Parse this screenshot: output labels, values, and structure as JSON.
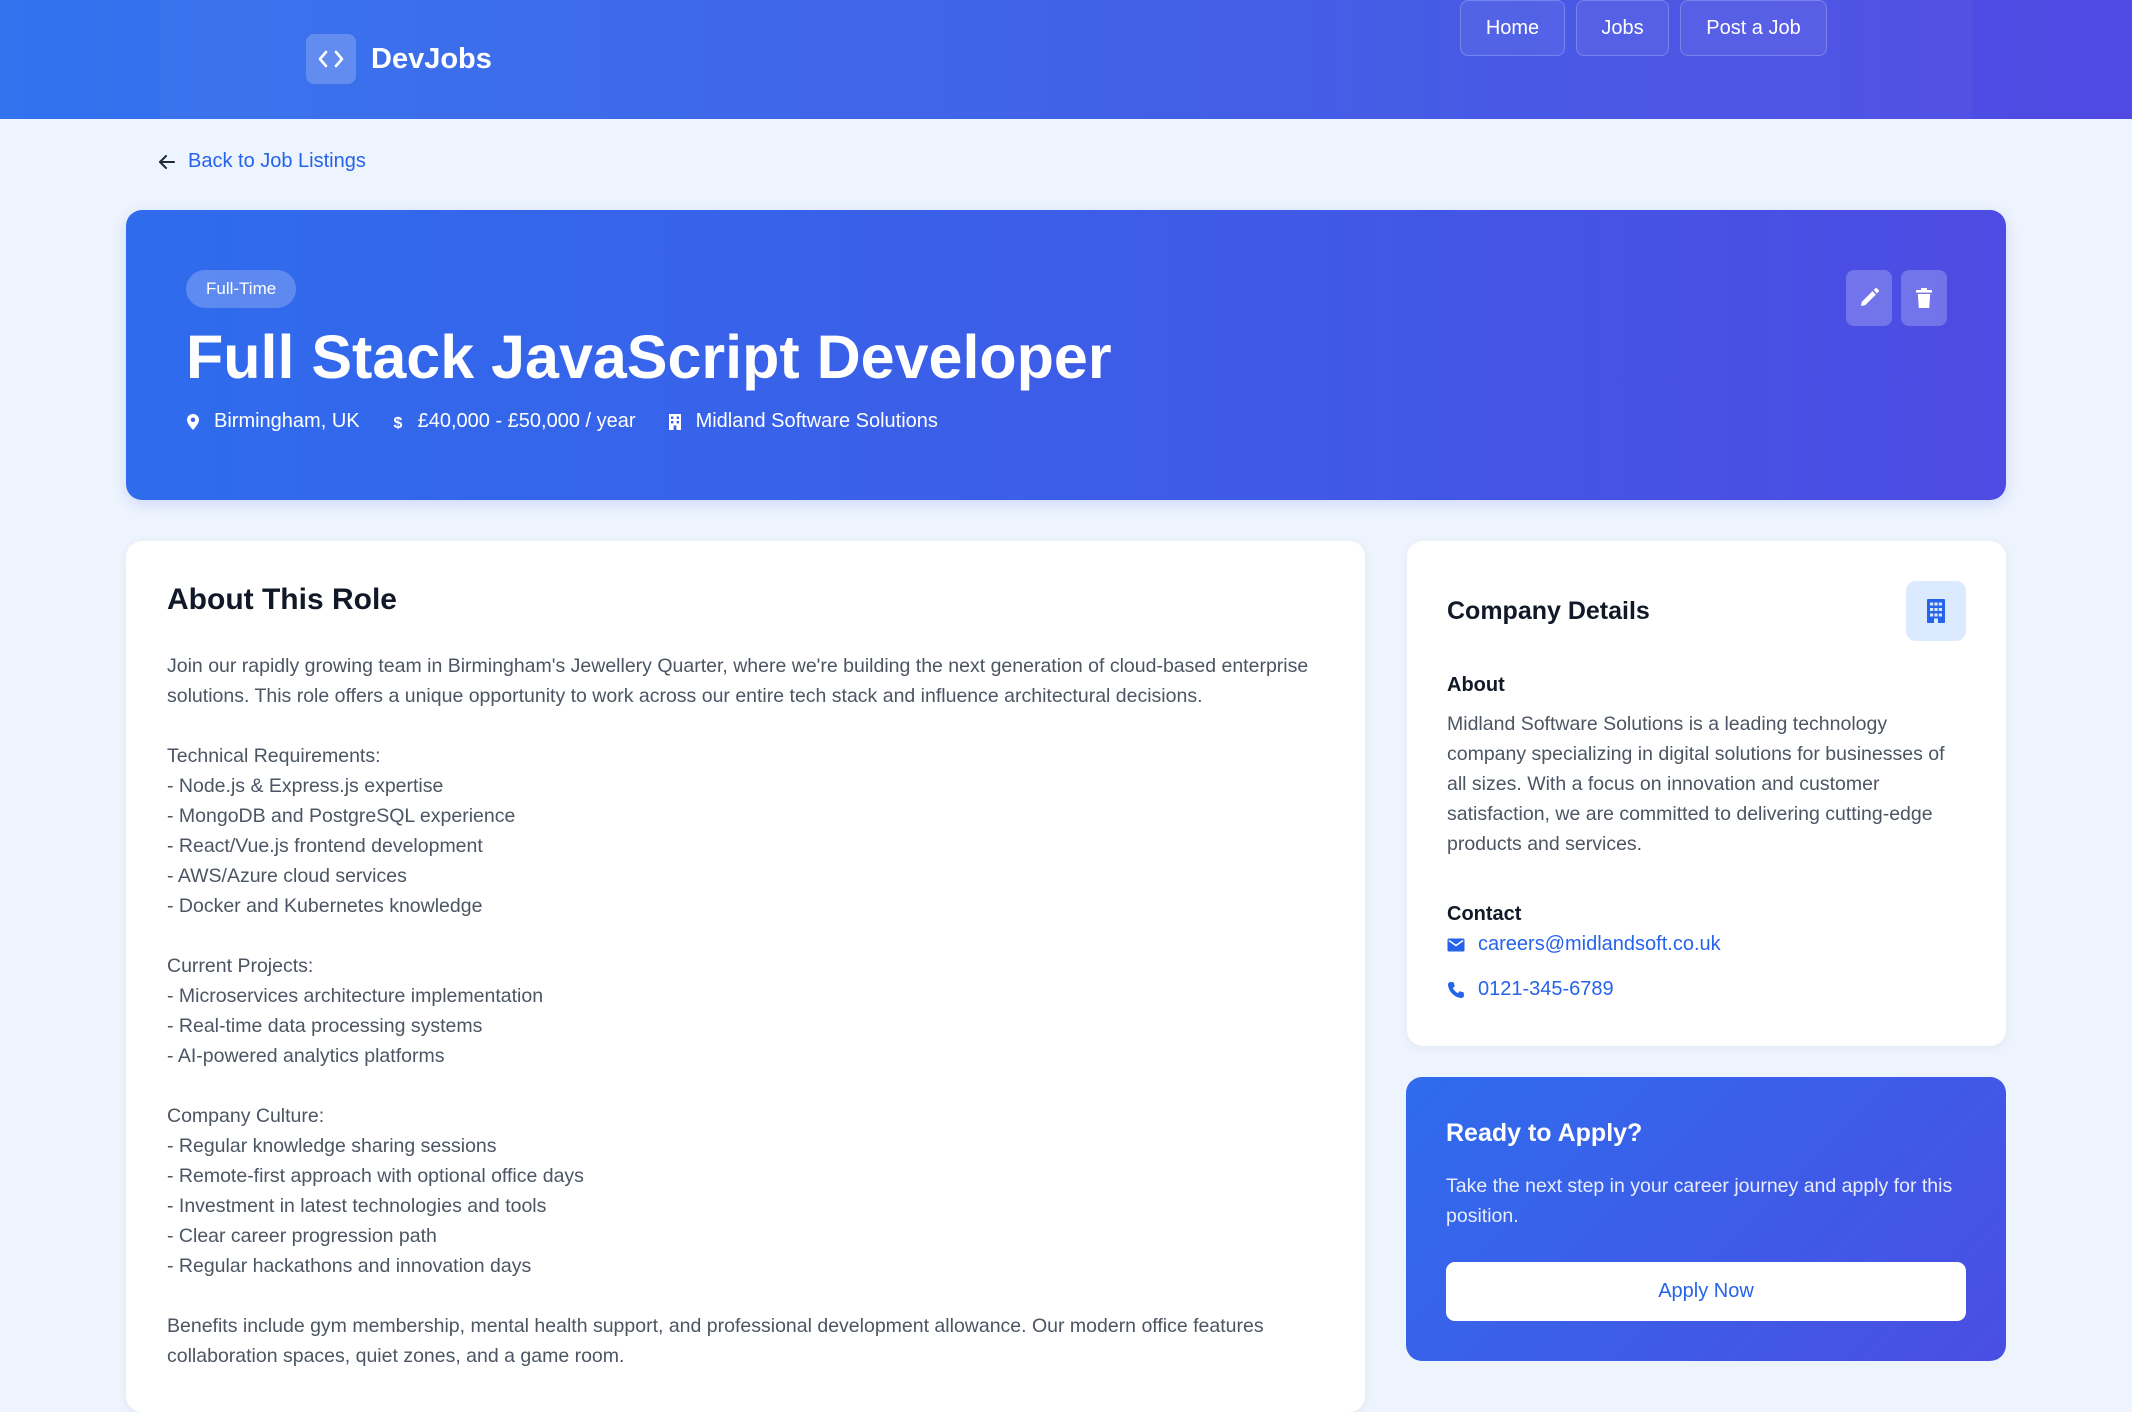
{
  "header": {
    "brand_name": "DevJobs",
    "logo_icon": "code-icon",
    "nav": [
      {
        "label": "Home"
      },
      {
        "label": "Jobs"
      },
      {
        "label": "Post a Job"
      }
    ]
  },
  "back_link": {
    "label": "Back to Job Listings",
    "icon": "arrow-left-icon"
  },
  "job": {
    "type_badge": "Full-Time",
    "title": "Full Stack JavaScript Developer",
    "location": "Birmingham, UK",
    "salary": "£40,000 - £50,000 / year",
    "company": "Midland Software Solutions",
    "actions": {
      "edit_icon": "pencil-icon",
      "delete_icon": "trash-icon"
    }
  },
  "about_role": {
    "title": "About This Role",
    "description": "Join our rapidly growing team in Birmingham's Jewellery Quarter, where we're building the next generation of cloud-based enterprise solutions. This role offers a unique opportunity to work across our entire tech stack and influence architectural decisions.\n\nTechnical Requirements:\n- Node.js & Express.js expertise\n- MongoDB and PostgreSQL experience\n- React/Vue.js frontend development\n- AWS/Azure cloud services\n- Docker and Kubernetes knowledge\n\nCurrent Projects:\n- Microservices architecture implementation\n- Real-time data processing systems\n- AI-powered analytics platforms\n\nCompany Culture:\n- Regular knowledge sharing sessions\n- Remote-first approach with optional office days\n- Investment in latest technologies and tools\n- Clear career progression path\n- Regular hackathons and innovation days\n\nBenefits include gym membership, mental health support, and professional development allowance. Our modern office features collaboration spaces, quiet zones, and a game room."
  },
  "company_details": {
    "title": "Company Details",
    "about_heading": "About",
    "about_text": "Midland Software Solutions is a leading technology company specializing in digital solutions for businesses of all sizes. With a focus on innovation and customer satisfaction, we are committed to delivering cutting-edge products and services.",
    "contact_heading": "Contact",
    "email": "careers@midlandsoft.co.uk",
    "phone": "0121-345-6789"
  },
  "apply": {
    "title": "Ready to Apply?",
    "text": "Take the next step in your career journey and apply for this position.",
    "button_label": "Apply Now"
  },
  "colors": {
    "accent": "#2563eb",
    "gradient_start": "#2f6ced",
    "gradient_end": "#4d4be3",
    "page_background": "#eef4fd"
  }
}
